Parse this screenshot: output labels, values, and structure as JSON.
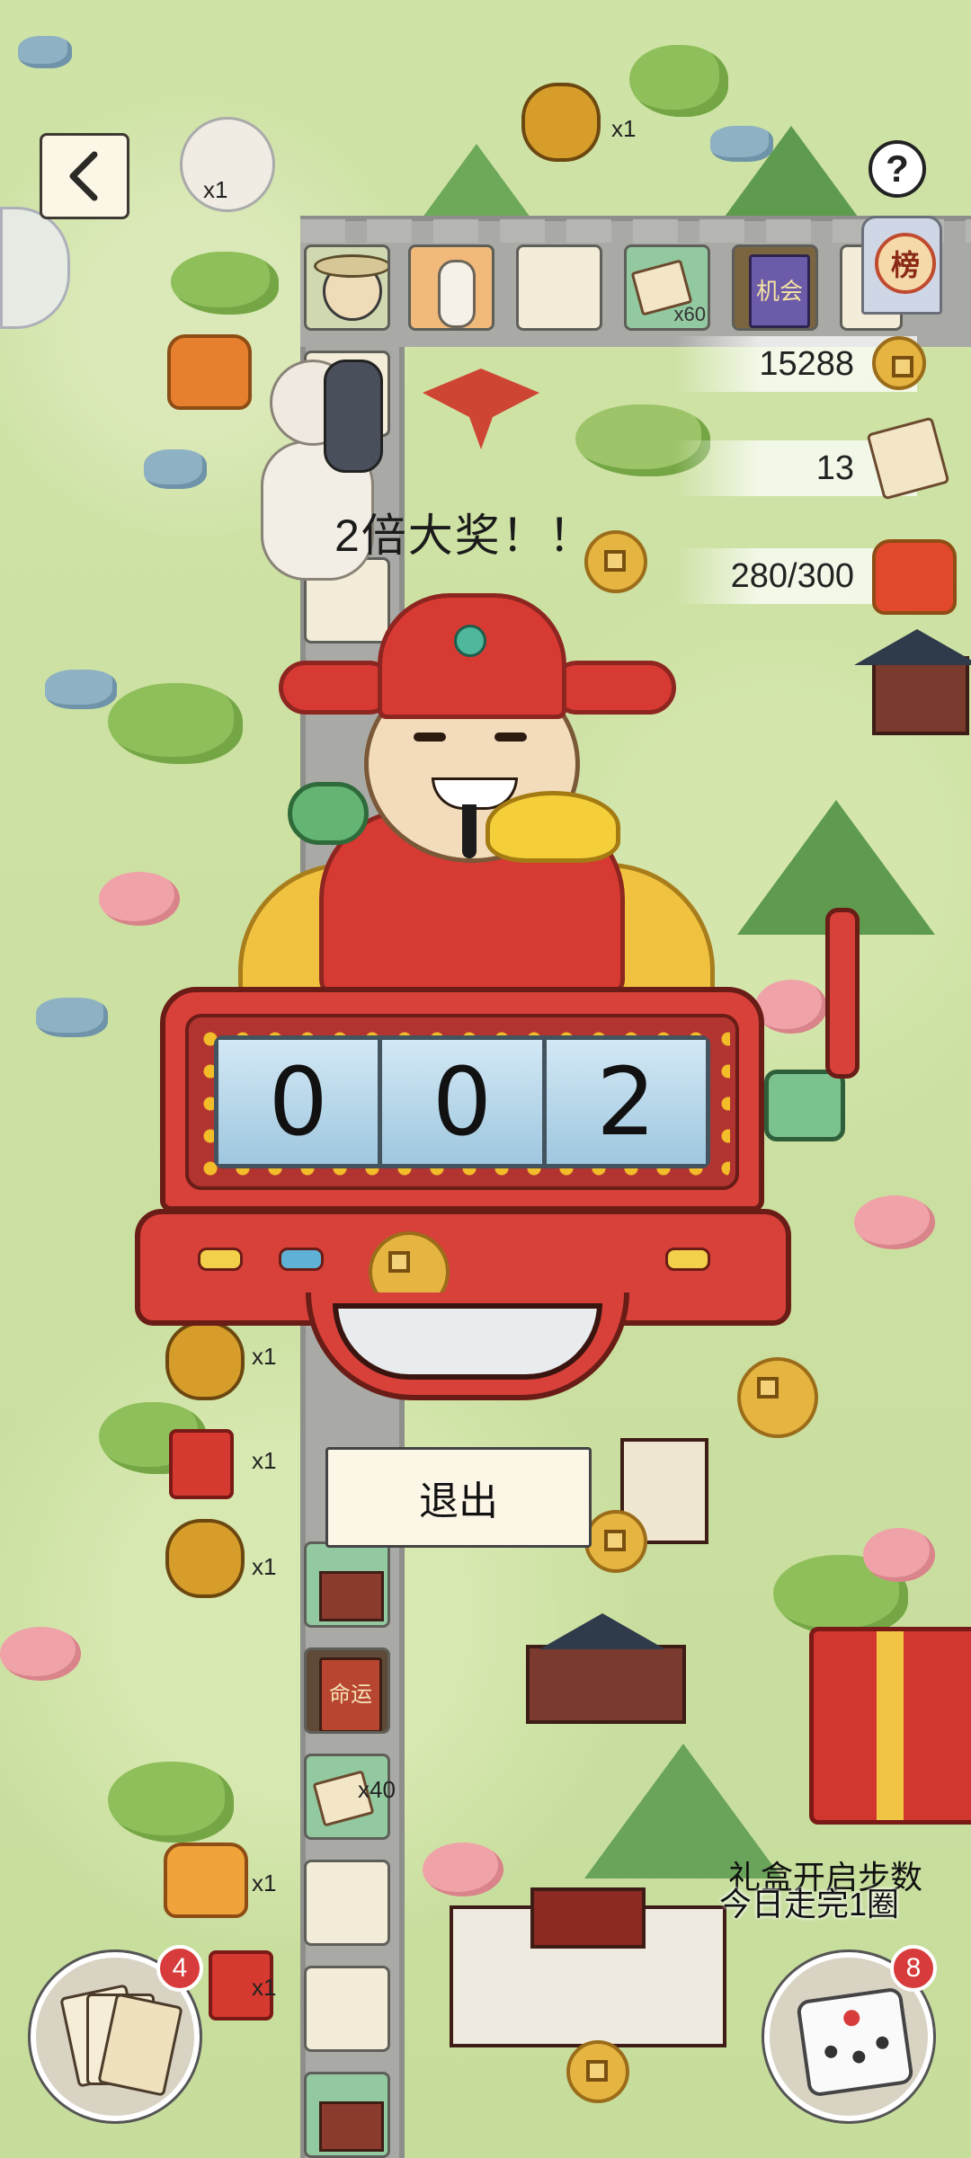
{
  "top_bar": {
    "back_label": "<",
    "help_label": "?",
    "rank_label": "榜",
    "top_item_count": "x1",
    "avatar_item_count": "x1"
  },
  "resources": {
    "coins": "15288",
    "tickets": "13",
    "progress": "280/300"
  },
  "board_top_row": [
    {
      "type": "character"
    },
    {
      "type": "alpaca"
    },
    {
      "type": "empty"
    },
    {
      "type": "ticket",
      "count": "x60"
    },
    {
      "type": "book",
      "label": "机会"
    },
    {
      "type": "empty"
    }
  ],
  "board_side_items": [
    {
      "type": "pot",
      "count": "x1"
    },
    {
      "type": "firecracker",
      "count": "x1"
    },
    {
      "type": "pot",
      "count": "x1"
    },
    {
      "type": "ticket",
      "count": "x40"
    },
    {
      "type": "bag",
      "count": "x1"
    },
    {
      "type": "firecracker",
      "count": "x1"
    }
  ],
  "fate_tile_label": "命运",
  "jackpot_text": "2倍大奖！！",
  "slot_machine": {
    "reels": [
      "0",
      "0",
      "2"
    ]
  },
  "exit_label": "退出",
  "gift_box": {
    "line1": "礼盒开启步数",
    "line2": "今日走完1圈"
  },
  "bottom": {
    "cards_badge": "4",
    "dice_badge": "8"
  },
  "colors": {
    "grass": "#cfe0a8",
    "slot_red": "#d8403a",
    "gold": "#f1c240",
    "badge_red": "#d83b3b"
  },
  "icons": {
    "back": "chevron-left-icon",
    "help": "question-icon",
    "rank": "leaderboard-icon",
    "coin": "coin-icon",
    "ticket": "ticket-icon",
    "progress": "lucky-bag-icon",
    "cards": "cards-icon",
    "dice": "dice-icon"
  }
}
